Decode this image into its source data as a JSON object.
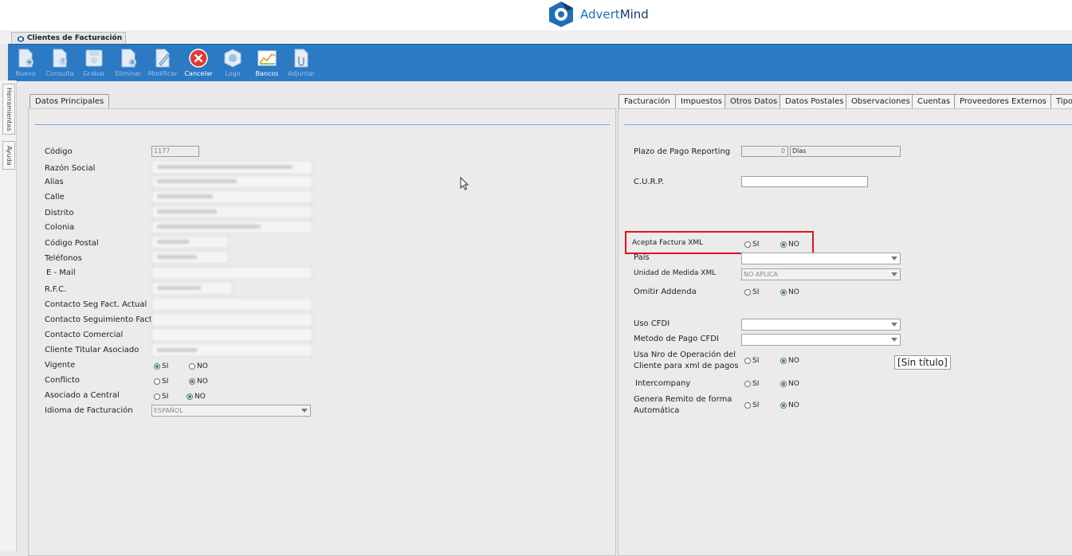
{
  "brand": {
    "name_a": "Advert",
    "name_b": "Mind"
  },
  "window": {
    "tab_title": "Clientes de Facturación"
  },
  "toolbar": [
    {
      "id": "nuevo",
      "label": "Nuevo",
      "enabled": false,
      "icon": "new-document-icon"
    },
    {
      "id": "consulta",
      "label": "Consulta",
      "enabled": false,
      "icon": "query-icon"
    },
    {
      "id": "grabar",
      "label": "Grabar",
      "enabled": false,
      "icon": "save-icon"
    },
    {
      "id": "eliminar",
      "label": "Eliminar",
      "enabled": false,
      "icon": "delete-document-icon"
    },
    {
      "id": "modificar",
      "label": "Modificar",
      "enabled": false,
      "icon": "edit-icon"
    },
    {
      "id": "cancelar",
      "label": "Cancelar",
      "enabled": true,
      "icon": "cancel-icon"
    },
    {
      "id": "logo",
      "label": "Logo",
      "enabled": false,
      "icon": "logo-icon"
    },
    {
      "id": "bancos",
      "label": "Bancos",
      "enabled": true,
      "icon": "chart-icon"
    },
    {
      "id": "adjuntar",
      "label": "Adjuntar",
      "enabled": false,
      "icon": "attach-icon"
    }
  ],
  "side_tabs": [
    "Herramientas",
    "Ayuda"
  ],
  "left": {
    "tab": "Datos Principales",
    "fields": {
      "codigo": {
        "label": "Código",
        "value": "1177"
      },
      "razon_social": {
        "label": "Razón Social"
      },
      "alias": {
        "label": "Alias"
      },
      "calle": {
        "label": "Calle"
      },
      "distrito": {
        "label": "Distrito"
      },
      "colonia": {
        "label": "Colonia"
      },
      "codigo_postal": {
        "label": "Código Postal"
      },
      "telefonos": {
        "label": "Teléfonos"
      },
      "email": {
        "label": "E - Mail"
      },
      "rfc": {
        "label": "R.F.C."
      },
      "contacto_seg_actual": {
        "label": "Contacto Seg Fact. Actual"
      },
      "contacto_seguimiento": {
        "label": "Contacto Seguimiento Fact."
      },
      "contacto_comercial": {
        "label": "Contacto Comercial"
      },
      "cliente_titular": {
        "label": "Cliente Titular Asociado"
      }
    },
    "vigente": {
      "label": "Vigente",
      "si": "SI",
      "no": "NO",
      "selected": "si"
    },
    "conflicto": {
      "label": "Conflicto",
      "si": "SI",
      "no": "NO",
      "selected": "no"
    },
    "asociado": {
      "label": "Asociado a Central",
      "si": "SI",
      "no": "NO",
      "selected": "no"
    },
    "idioma": {
      "label": "Idioma de Facturación",
      "value": "ESPAÑOL"
    }
  },
  "right": {
    "tabs": [
      "Facturación",
      "Impuestos",
      "Otros Datos",
      "Datos Postales",
      "Observaciones",
      "Cuentas",
      "Proveedores Externos",
      "Tipo"
    ],
    "active_tab": "Otros Datos",
    "plazo": {
      "label": "Plazo de Pago Reporting",
      "value": "0",
      "unit": "Días"
    },
    "curp": {
      "label": "C.U.R.P."
    },
    "acepta_xml": {
      "label": "Acepta Factura XML",
      "si": "SI",
      "no": "NO",
      "selected": "no"
    },
    "pais": {
      "label": "País"
    },
    "unidad_medida": {
      "label": "Unidad de Medida XML",
      "value": "NO APLICA"
    },
    "omitir_addenda": {
      "label": "Omitir Addenda",
      "si": "SI",
      "no": "NO",
      "selected": "no"
    },
    "uso_cfdi": {
      "label": "Uso CFDI"
    },
    "metodo_pago": {
      "label": "Metodo de Pago CFDI"
    },
    "usa_nro": {
      "label_1": "Usa Nro de Operación del",
      "label_2": "Cliente para xml de pagos",
      "si": "SI",
      "no": "NO",
      "selected": "no"
    },
    "intercompany": {
      "label": "Intercompany",
      "si": "SI",
      "no": "NO",
      "selected": "no"
    },
    "genera_remito": {
      "label_1": "Genera Remito de forma",
      "label_2": "Automática",
      "si": "SI",
      "no": "NO",
      "selected": "no"
    },
    "tooltip": "[Sin título]"
  },
  "colors": {
    "toolbar": "#2c79c4",
    "highlight": "#e0141e",
    "radio_on": "#2e9a3a"
  }
}
